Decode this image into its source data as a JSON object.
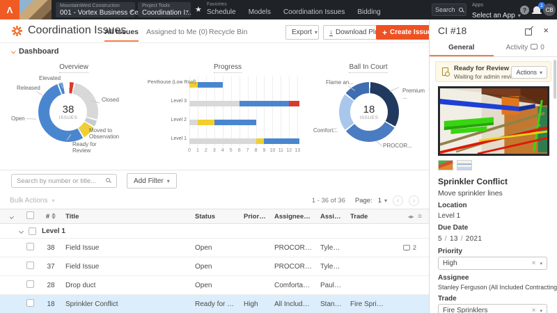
{
  "topnav": {
    "logo_glyph": "Λ",
    "company_selector": {
      "label": "MountainWest Construction",
      "value": "001 - Vortex Business Cen..."
    },
    "tool_selector": {
      "label": "Project Tools",
      "value": "Coordination I..."
    },
    "favorites_label": "Favorites",
    "nav_items": [
      "Schedule",
      "Models",
      "Coordination Issues",
      "Bidding"
    ],
    "search_label": "Search",
    "apps_label": "Apps",
    "apps_value": "Select an App",
    "help_glyph": "?",
    "notification_count": "1",
    "avatar_initials": "CB"
  },
  "page_header": {
    "title": "Coordination Issues",
    "tabs": [
      {
        "label": "All Issues"
      },
      {
        "label": "Assigned to Me (0)"
      },
      {
        "label": "Recycle Bin"
      }
    ],
    "export_label": "Export",
    "download_plugin_label": "Download Plugin",
    "create_issue_label": "Create Issue"
  },
  "dashboard": {
    "section_label": "Dashboard"
  },
  "chart_data": [
    {
      "type": "pie",
      "title": "Overview",
      "center_value": "38",
      "center_label": "ISSUES",
      "segments": [
        {
          "label": "Elevated",
          "color": "#d93a2b",
          "pct": 3
        },
        {
          "label": "Closed",
          "color": "#d8d8d8",
          "pct": 26
        },
        {
          "label": "Moved to\nObservation",
          "color": "#c7cbd1",
          "pct": 4
        },
        {
          "label": "Ready for\nReview",
          "color": "#f2cf2e",
          "pct": 8
        },
        {
          "label": "Open",
          "color": "#4a86d0",
          "pct": 53
        },
        {
          "label": "Released",
          "color": "#4a86d0",
          "pct": 3
        }
      ]
    },
    {
      "type": "bar",
      "title": "Progress",
      "orientation": "horizontal-stacked",
      "xlabel": "",
      "ylabel": "",
      "xmax": 13.4,
      "xticks": [
        0,
        1,
        2,
        3,
        4,
        5,
        6,
        7,
        8,
        9,
        10,
        11,
        12,
        13
      ],
      "series_colors": {
        "Closed": "#d8d8d8",
        "Ready for Review": "#f2cf2e",
        "Open": "#4a86d0",
        "Elevated": "#d93a2b"
      },
      "categories": [
        "Penthouse (Low Roof)",
        "Level 3",
        "Level 2",
        "Level 1"
      ],
      "bars": [
        {
          "category": "Penthouse (Low Roof)",
          "segments": [
            {
              "status": "Ready for Review",
              "value": 1
            },
            {
              "status": "Open",
              "value": 3
            }
          ]
        },
        {
          "category": "Level 3",
          "segments": [
            {
              "status": "Closed",
              "value": 6
            },
            {
              "status": "Open",
              "value": 6
            },
            {
              "status": "Elevated",
              "value": 1.2
            }
          ]
        },
        {
          "category": "Level 2",
          "segments": [
            {
              "status": "Closed",
              "value": 1
            },
            {
              "status": "Ready for Review",
              "value": 2
            },
            {
              "status": "Open",
              "value": 5
            }
          ]
        },
        {
          "category": "Level 1",
          "segments": [
            {
              "status": "Closed",
              "value": 8
            },
            {
              "status": "Ready for Review",
              "value": 1
            },
            {
              "status": "Open",
              "value": 4.2
            }
          ]
        }
      ]
    },
    {
      "type": "pie",
      "title": "Ball In Court",
      "center_value": "18",
      "center_label": "ISSUES",
      "segments": [
        {
          "label": "Premium ...",
          "color": "#21395e",
          "pct": 33
        },
        {
          "label": "PROCOR...",
          "color": "#4a7cc2",
          "pct": 31
        },
        {
          "label": "Comfort...",
          "color": "#a9c7ea",
          "pct": 21
        },
        {
          "label": "Flame an...",
          "color": "#3f6db1",
          "pct": 15
        }
      ]
    }
  ],
  "filter_bar": {
    "search_placeholder": "Search by number or title...",
    "add_filter_label": "Add Filter"
  },
  "toolbar": {
    "bulk_actions_label": "Bulk Actions",
    "range_text": "1 - 36 of 36",
    "page_label": "Page:",
    "page_value": "1"
  },
  "table": {
    "columns": [
      "#",
      "Title",
      "Status",
      "Priority",
      "Assignee Company",
      "Assignee",
      "Trade"
    ],
    "group_label": "Level 1",
    "rows": [
      {
        "num": "38",
        "title": "Field Issue",
        "status": "Open",
        "priority": "",
        "company": "PROCORE Te...",
        "assignee": "Tyler F...",
        "trade": "",
        "comments": "2",
        "selected": false
      },
      {
        "num": "37",
        "title": "Field Issue",
        "status": "Open",
        "priority": "",
        "company": "PROCORE Te...",
        "assignee": "Tyler F...",
        "trade": "",
        "comments": "",
        "selected": false
      },
      {
        "num": "28",
        "title": "Drop duct",
        "status": "Open",
        "priority": "",
        "company": "Comfortable ...",
        "assignee": "Paul Bl...",
        "trade": "",
        "comments": "",
        "selected": false
      },
      {
        "num": "18",
        "title": "Sprinkler Conflict",
        "status": "Ready for Review",
        "priority": "High",
        "company": "All Included C...",
        "assignee": "Stanley...",
        "trade": "Fire Sprinklers",
        "comments": "",
        "selected": true
      }
    ]
  },
  "detail_panel": {
    "title": "CI #18",
    "tabs": [
      {
        "label": "General"
      },
      {
        "label": "Activity",
        "badge": "0"
      }
    ],
    "banner": {
      "title": "Ready for Review",
      "subtitle": "Waiting for admin review.",
      "action_label": "Actions"
    },
    "issue": {
      "title": "Sprinkler Conflict",
      "description": "Move sprinkler lines",
      "location_label": "Location",
      "location_value": "Level 1",
      "due_date_label": "Due Date",
      "due_month": "5",
      "due_day": "13",
      "due_year": "2021",
      "priority_label": "Priority",
      "priority_value": "High",
      "assignee_label": "Assignee",
      "assignee_value": "Stanley Ferguson (All Included Contracting)",
      "trade_label": "Trade",
      "trade_value": "Fire Sprinklers"
    }
  },
  "colors": {
    "brand_orange": "#f05b24",
    "accent_orange": "#f47b3f",
    "create_button": "#ee5223",
    "selected_row": "#dcedfb",
    "banner_bg": "#fdf8e7",
    "status_blue": "#4a86d0",
    "status_yellow": "#f2cf2e",
    "status_red": "#d93a2b",
    "status_gray": "#d8d8d8"
  }
}
